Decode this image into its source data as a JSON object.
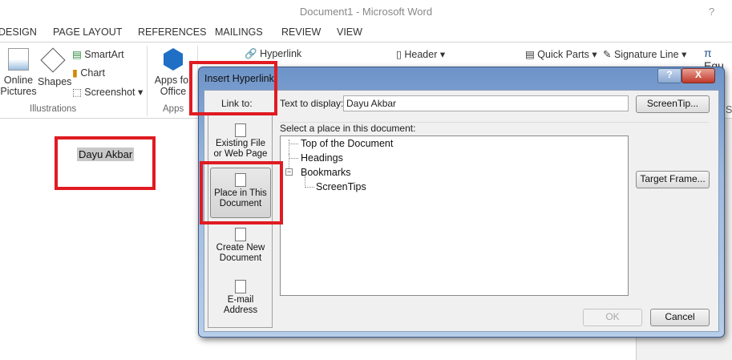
{
  "window": {
    "title": "Document1 - Microsoft Word",
    "help": "?"
  },
  "tabs": [
    "DESIGN",
    "PAGE LAYOUT",
    "REFERENCES",
    "MAILINGS",
    "REVIEW",
    "VIEW"
  ],
  "ribbon": {
    "online_pictures": [
      "Online",
      "Pictures"
    ],
    "shapes": "Shapes",
    "smartart": "SmartArt",
    "chart": "Chart",
    "screenshot": "Screenshot",
    "illustrations": "Illustrations",
    "apps_for_office": [
      "Apps for",
      "Office"
    ],
    "apps": "Apps",
    "hyperlink": "Hyperlink",
    "header": "Header",
    "quick_parts": "Quick Parts",
    "signature_line": "Signature Line",
    "equation": "Equ",
    "symbols": "Sym"
  },
  "document": {
    "text": "Dayu Akbar"
  },
  "dialog": {
    "title": "Insert Hyperlink",
    "help": "?",
    "close": "X",
    "link_to": "Link to:",
    "link_options": [
      {
        "label1": "Existing File",
        "label2": "or Web Page",
        "icon": "web-page-icon"
      },
      {
        "label1": "Place in This",
        "label2": "Document",
        "icon": "place-document-icon",
        "selected": true
      },
      {
        "label1": "Create New",
        "label2": "Document",
        "icon": "new-document-icon"
      },
      {
        "label1": "E-mail",
        "label2": "Address",
        "icon": "email-icon"
      }
    ],
    "text_to_display_label": "Text to display:",
    "text_to_display": "Dayu Akbar",
    "screentip": "ScreenTip...",
    "select_place_label": "Select a place in this document:",
    "tree": [
      "Top of the Document",
      "Headings",
      "Bookmarks",
      "ScreenTips"
    ],
    "target_frame": "Target Frame...",
    "ok": "OK",
    "cancel": "Cancel"
  },
  "colors": {
    "highlight_box": "#e01b22",
    "dialog_title": "#8fb0da"
  }
}
